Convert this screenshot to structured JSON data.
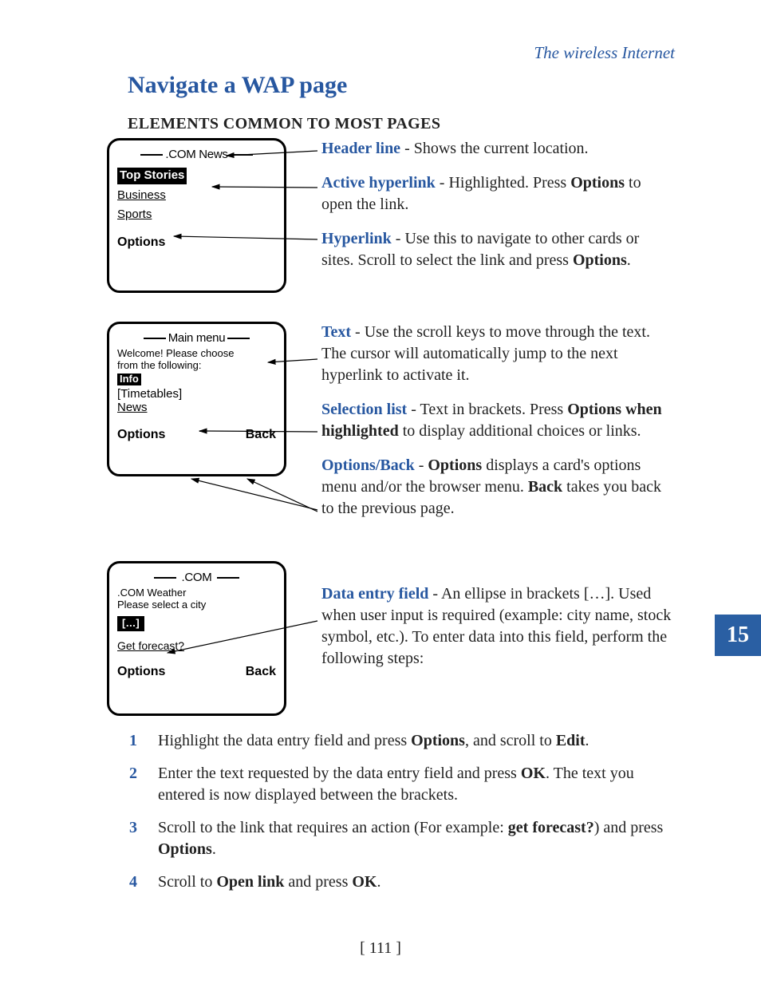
{
  "running_head": "The wireless Internet",
  "h1": "Navigate a WAP page",
  "h2": "ELEMENTS COMMON TO MOST PAGES",
  "chapter_tab": "15",
  "page_number": "[ 111 ]",
  "screen1": {
    "title": ".COM News",
    "active": "Top Stories",
    "link1": "Business",
    "link2": "Sports",
    "soft_left": "Options"
  },
  "screen2": {
    "title": "Main menu",
    "line1": "Welcome! Please choose",
    "line2": "from the following:",
    "active": "Info",
    "sel": "[Timetables]",
    "link": "News",
    "soft_left": "Options",
    "soft_right": "Back"
  },
  "screen3": {
    "title": ".COM",
    "line1": ".COM Weather",
    "line2": "Please select a city",
    "entry": "[…]",
    "link": "Get forecast?",
    "soft_left": "Options",
    "soft_right": "Back"
  },
  "d_header_t": "Header line",
  "d_header_b": " - Shows the current location.",
  "d_active_t": "Active hyperlink",
  "d_active_b1": " - Highlighted. Press ",
  "d_active_k": "Options",
  "d_active_b2": " to open the link.",
  "d_hyper_t": "Hyperlink",
  "d_hyper_b1": " - Use this to navigate to other cards or sites. Scroll to select the link and press ",
  "d_hyper_k": "Options",
  "d_hyper_b2": ".",
  "d_text_t": "Text",
  "d_text_b": " - Use the scroll keys to move through the text. The cursor will automatically jump to the next hyperlink to activate it.",
  "d_sel_t": "Selection list",
  "d_sel_b1": " - Text in brackets. Press ",
  "d_sel_k1": "Options",
  "d_sel_b2": " ",
  "d_sel_k2": "when highlighted",
  "d_sel_b3": " to display additional choices or links.",
  "d_ob_t": "Options/Back",
  "d_ob_b1": " - ",
  "d_ob_k1": "Options",
  "d_ob_b2": " displays a card's options menu and/or the browser menu. ",
  "d_ob_k2": "Back",
  "d_ob_b3": " takes you back to the previous page.",
  "d_de_t": "Data entry field",
  "d_de_b": " - An ellipse in brackets […]. Used when user input is required (example: city name, stock symbol, etc.). To enter data into this field, perform the following steps:",
  "steps": {
    "1": {
      "n": "1",
      "a": "Highlight the data entry field and press ",
      "k1": "Options",
      "b": ", and scroll to ",
      "k2": "Edit",
      "c": "."
    },
    "2": {
      "n": "2",
      "a": "Enter the text requested by the data entry field and press ",
      "k1": "OK",
      "b": ". The text you entered is now displayed between the brackets."
    },
    "3": {
      "n": "3",
      "a": "Scroll to the link that requires an action (For example: ",
      "k1": "get forecast?",
      "b": ") and press ",
      "k2": "Options",
      "c": "."
    },
    "4": {
      "n": "4",
      "a": "Scroll to ",
      "k1": "Open link",
      "b": " and press ",
      "k2": "OK",
      "c": "."
    }
  }
}
